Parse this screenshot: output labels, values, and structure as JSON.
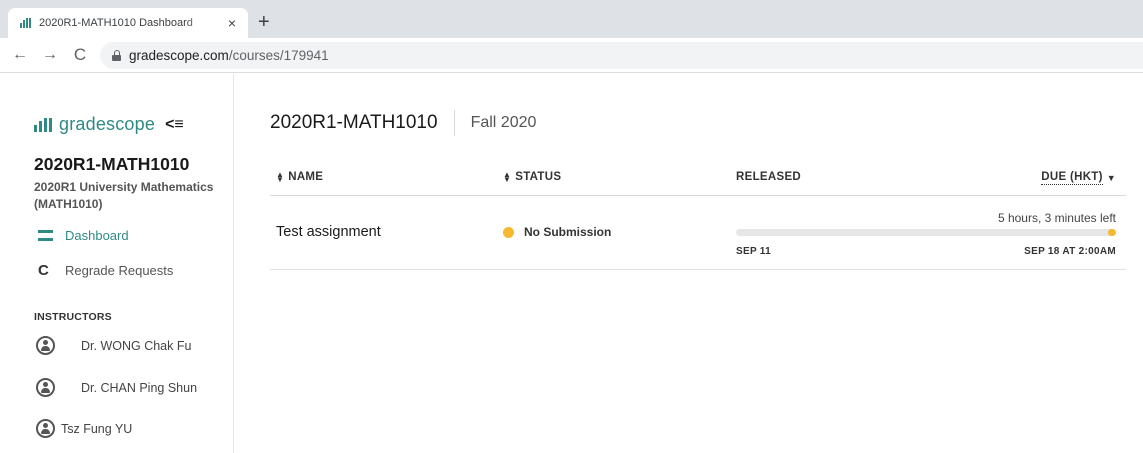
{
  "browser": {
    "tab_title": "2020R1-MATH1010 Dashboard",
    "tab_close": "×",
    "new_tab": "+",
    "url_host": "gradescope.com",
    "url_path": "/courses/179941",
    "back": "←",
    "forward": "→",
    "reload": "C"
  },
  "sidebar": {
    "brand": "gradescope",
    "collapse": "<≡",
    "course_code": "2020R1-MATH1010",
    "course_full_name": "2020R1 University Mathematics (MATH1010)",
    "nav": [
      {
        "label": "Dashboard",
        "icon": "dashboard-icon",
        "active": true
      },
      {
        "label": "Regrade Requests",
        "icon": "regrade-icon",
        "active": false
      }
    ],
    "instructors_heading": "INSTRUCTORS",
    "instructors": [
      "Dr. WONG Chak Fu",
      "Dr. CHAN Ping Shun",
      "Tsz Fung YU"
    ]
  },
  "main": {
    "title": "2020R1-MATH1010",
    "term": "Fall 2020",
    "columns": {
      "name": "NAME",
      "status": "STATUS",
      "released": "RELEASED",
      "due": "DUE (HKT)"
    },
    "assignments": [
      {
        "name": "Test assignment",
        "status": "No Submission",
        "time_left": "5 hours, 3 minutes left",
        "released": "SEP 11",
        "due": "SEP 18 AT 2:00AM",
        "progress": 0.98
      }
    ]
  },
  "colors": {
    "brand": "#2f8a86",
    "status_dot": "#f5b82e",
    "progress_fill": "#f5b82e"
  }
}
